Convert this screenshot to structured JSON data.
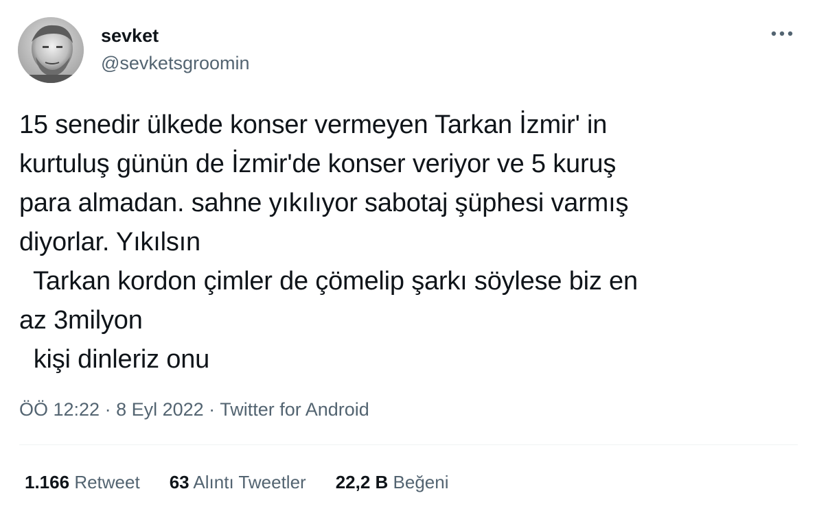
{
  "user": {
    "display_name": "sevket",
    "handle": "@sevketsgroomin",
    "avatar_icon": "profile-photo"
  },
  "more_icon": "more-horizontal-icon",
  "tweet": {
    "text": "15 senedir ülkede konser vermeyen Tarkan İzmir' in\nkurtuluş günün de İzmir'de konser veriyor ve 5 kuruş\npara almadan. sahne yıkılıyor sabotaj şüphesi varmış\ndiyorlar. Yıkılsın\n  Tarkan kordon çimler de çömelip şarkı söylese biz en\naz 3milyon\n  kişi dinleriz onu"
  },
  "meta": {
    "time": "ÖÖ 12:22",
    "separator": " · ",
    "date": "8 Eyl 2022",
    "source": "Twitter for Android"
  },
  "stats": [
    {
      "count": "1.166",
      "label": "Retweet"
    },
    {
      "count": "63",
      "label": "Alıntı Tweetler"
    },
    {
      "count": "22,2 B",
      "label": "Beğeni"
    }
  ],
  "colors": {
    "text_primary": "#0f1419",
    "text_secondary": "#536471",
    "divider": "#eff3f4"
  }
}
